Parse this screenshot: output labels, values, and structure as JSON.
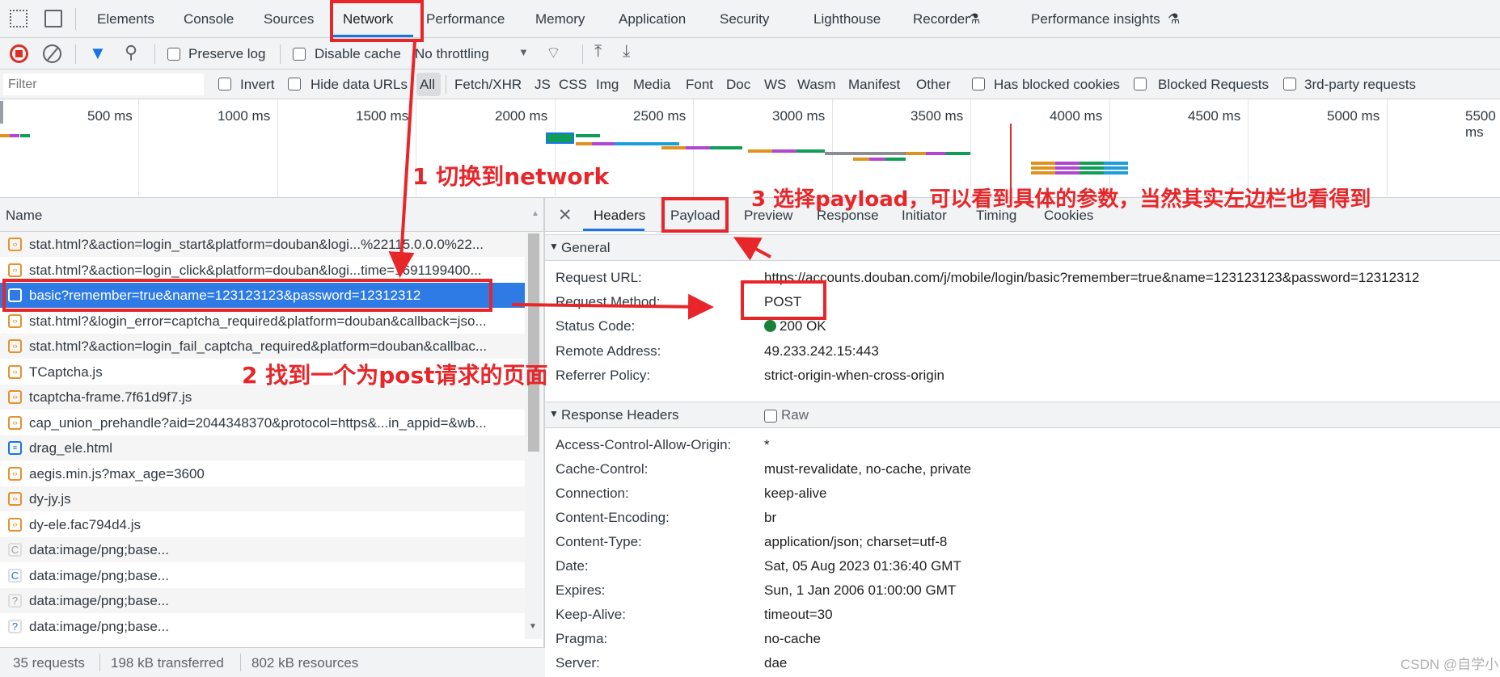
{
  "tabs": [
    "Elements",
    "Console",
    "Sources",
    "Network",
    "Performance",
    "Memory",
    "Application",
    "Security",
    "Lighthouse",
    "Recorder",
    "Performance insights"
  ],
  "toolbar": {
    "preserve_log": "Preserve log",
    "disable_cache": "Disable cache",
    "throttling": "No throttling"
  },
  "filter": {
    "placeholder": "Filter",
    "invert": "Invert",
    "hide_data_urls": "Hide data URLs",
    "types": [
      "All",
      "Fetch/XHR",
      "JS",
      "CSS",
      "Img",
      "Media",
      "Font",
      "Doc",
      "WS",
      "Wasm",
      "Manifest",
      "Other"
    ],
    "has_blocked_cookies": "Has blocked cookies",
    "blocked_requests": "Blocked Requests",
    "third_party": "3rd-party requests"
  },
  "timeline": {
    "ticks": [
      "500 ms",
      "1000 ms",
      "1500 ms",
      "2000 ms",
      "2500 ms",
      "3000 ms",
      "3500 ms",
      "4000 ms",
      "4500 ms",
      "5000 ms",
      "5500 ms"
    ]
  },
  "requests": {
    "header": "Name",
    "rows": [
      {
        "name": "stat.html?&action=login_start&platform=douban&logi...%22115.0.0.0%22...",
        "type": "script"
      },
      {
        "name": "stat.html?&action=login_click&platform=douban&logi...time=1691199400...",
        "type": "script"
      },
      {
        "name": "basic?remember=true&name=123123123&password=12312312",
        "type": "xhr",
        "selected": true
      },
      {
        "name": "stat.html?&login_error=captcha_required&platform=douban&callback=jso...",
        "type": "script"
      },
      {
        "name": "stat.html?&action=login_fail_captcha_required&platform=douban&callbac...",
        "type": "script"
      },
      {
        "name": "TCaptcha.js",
        "type": "script"
      },
      {
        "name": "tcaptcha-frame.7f61d9f7.js",
        "type": "script"
      },
      {
        "name": "cap_union_prehandle?aid=2044348370&protocol=https&...in_appid=&wb...",
        "type": "script"
      },
      {
        "name": "drag_ele.html",
        "type": "document"
      },
      {
        "name": "aegis.min.js?max_age=3600",
        "type": "script"
      },
      {
        "name": "dy-jy.js",
        "type": "script"
      },
      {
        "name": "dy-ele.fac794d4.js",
        "type": "script"
      },
      {
        "name": "data:image/png;base...",
        "type": "image-gray"
      },
      {
        "name": "data:image/png;base...",
        "type": "image-blue"
      },
      {
        "name": "data:image/png;base...",
        "type": "image-gray-q"
      },
      {
        "name": "data:image/png;base...",
        "type": "image-blue-q"
      }
    ]
  },
  "status": {
    "requests": "35 requests",
    "transferred": "198 kB transferred",
    "resources": "802 kB resources"
  },
  "detail": {
    "tabs": [
      "Headers",
      "Payload",
      "Preview",
      "Response",
      "Initiator",
      "Timing",
      "Cookies"
    ],
    "general": {
      "title": "General",
      "rows": [
        [
          "Request URL:",
          "https://accounts.douban.com/j/mobile/login/basic?remember=true&name=123123123&password=12312312"
        ],
        [
          "Request Method:",
          "POST"
        ],
        [
          "Status Code:",
          "200 OK"
        ],
        [
          "Remote Address:",
          "49.233.242.15:443"
        ],
        [
          "Referrer Policy:",
          "strict-origin-when-cross-origin"
        ]
      ]
    },
    "response": {
      "title": "Response Headers",
      "raw": "Raw",
      "rows": [
        [
          "Access-Control-Allow-Origin:",
          "*"
        ],
        [
          "Cache-Control:",
          "must-revalidate, no-cache, private"
        ],
        [
          "Connection:",
          "keep-alive"
        ],
        [
          "Content-Encoding:",
          "br"
        ],
        [
          "Content-Type:",
          "application/json; charset=utf-8"
        ],
        [
          "Date:",
          "Sat, 05 Aug 2023 01:36:40 GMT"
        ],
        [
          "Expires:",
          "Sun, 1 Jan 2006 01:00:00 GMT"
        ],
        [
          "Keep-Alive:",
          "timeout=30"
        ],
        [
          "Pragma:",
          "no-cache"
        ],
        [
          "Server:",
          "dae"
        ]
      ]
    }
  },
  "annotations": {
    "step1": "1 切换到network",
    "step2": "2 找到一个为post请求的页面",
    "step3": "3 选择payload，可以看到具体的参数，当然其实左边栏也看得到"
  },
  "watermark": "CSDN @自学小白菜",
  "colors": {
    "accent": "#1a73e8",
    "annotation": "#e8262a",
    "selected_row": "#2e7be6",
    "status_ok": "#188038"
  }
}
